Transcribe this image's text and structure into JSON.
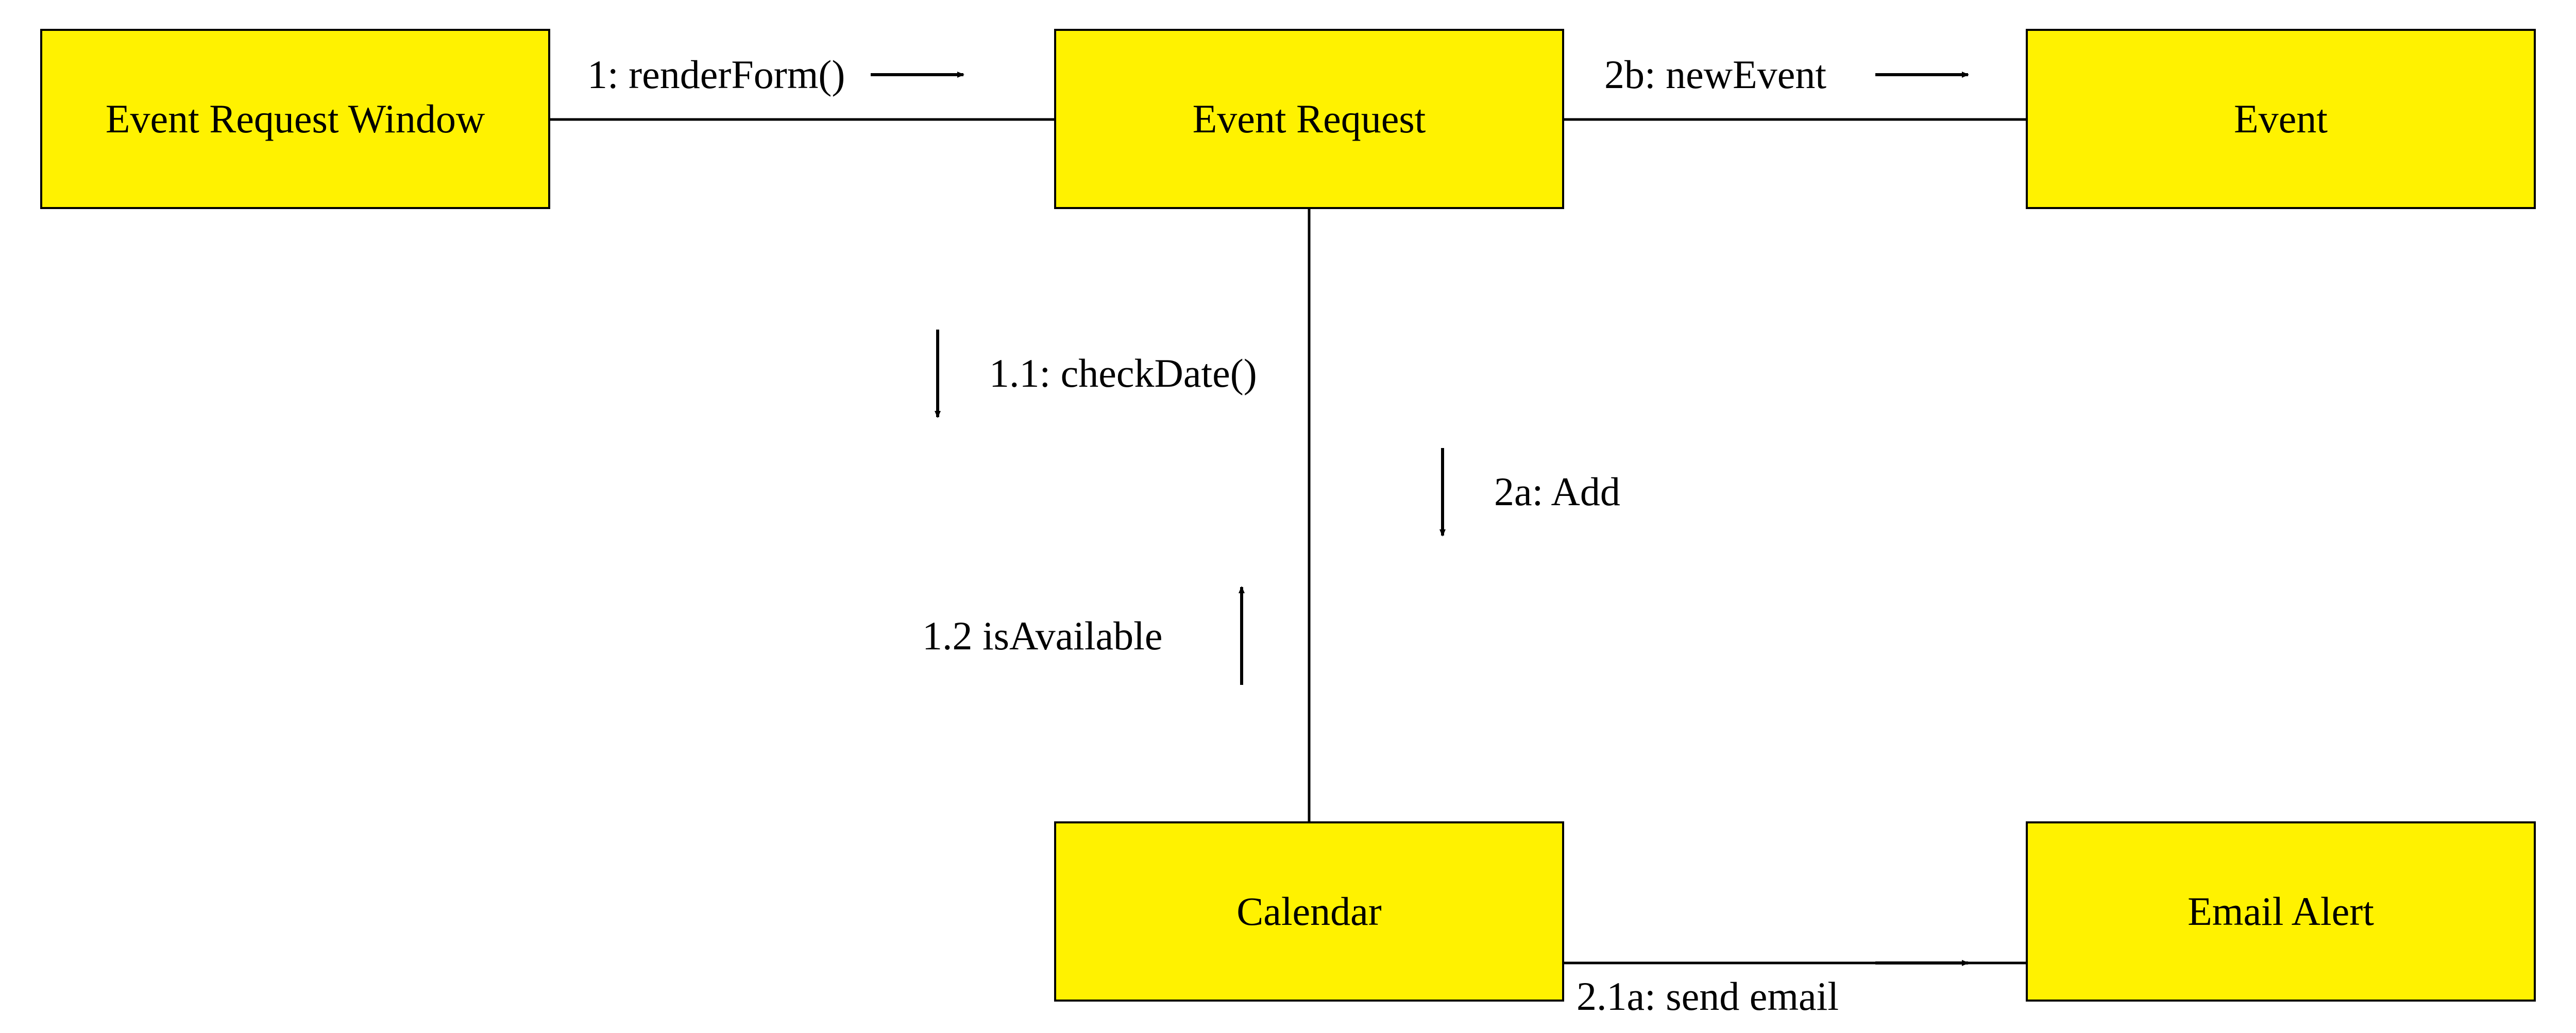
{
  "nodes": {
    "event_request_window": "Event Request Window",
    "event_request": "Event Request",
    "event": "Event",
    "calendar": "Calendar",
    "email_alert": "Email Alert"
  },
  "messages": {
    "render_form": "1: renderForm()",
    "check_date": "1.1: checkDate()",
    "is_available": "1.2 isAvailable",
    "add": "2a: Add",
    "new_event": "2b: newEvent",
    "send_email": "2.1a: send email"
  }
}
